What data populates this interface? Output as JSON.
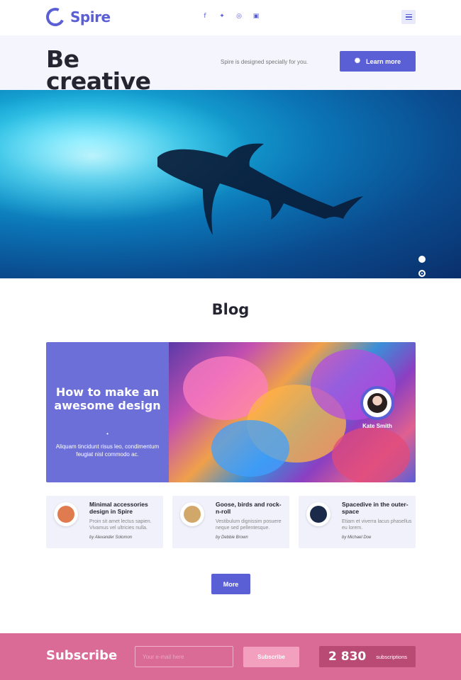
{
  "header": {
    "logo": "Spire",
    "social": [
      {
        "icon": "facebook-icon",
        "glyph": "f"
      },
      {
        "icon": "twitter-icon",
        "glyph": "✦"
      },
      {
        "icon": "dribbble-icon",
        "glyph": "◎"
      },
      {
        "icon": "linkedin-icon",
        "glyph": "▣"
      }
    ]
  },
  "hero": {
    "title_line1": "Be",
    "title_line2": "creative",
    "tagline": "Spire is designed specially for you.",
    "cta_label": "Learn more",
    "down_glyph": "↓"
  },
  "blog": {
    "heading": "Blog",
    "feature": {
      "title": "How to make an awesome design",
      "bullet": "•",
      "description": "Aliquam tincidunt risus leo, condimentum feugiat nisl commodo ac.",
      "author": "Kate Smith"
    },
    "cards": [
      {
        "title": "Minimal accessories design in Spire",
        "text": "Proin sit amet lectus sapien. Vivamus vel ultricies nulla.",
        "by": "by Alexander Solomon",
        "thumb_color": "#e07a4f"
      },
      {
        "title": "Goose, birds and rock-n-roll",
        "text": "Vestibulum dignissim posuere neque sed pellentesque.",
        "by": "by Debbie Brown",
        "thumb_color": "#d2a86a"
      },
      {
        "title": "Spacedive in the outer-space",
        "text": "Etiam et viverra lacus phasellus eu lorem.",
        "by": "by Michael Doe",
        "thumb_color": "#1c2a4a"
      }
    ],
    "more_label": "More"
  },
  "subscribe": {
    "title": "Subscribe",
    "placeholder": "Your e-mail here",
    "button_label": "Subscribe",
    "count": "2 830",
    "count_label": "subscriptions"
  },
  "colors": {
    "accent": "#5a5fd6",
    "subscribe_bg": "#d96b96"
  }
}
